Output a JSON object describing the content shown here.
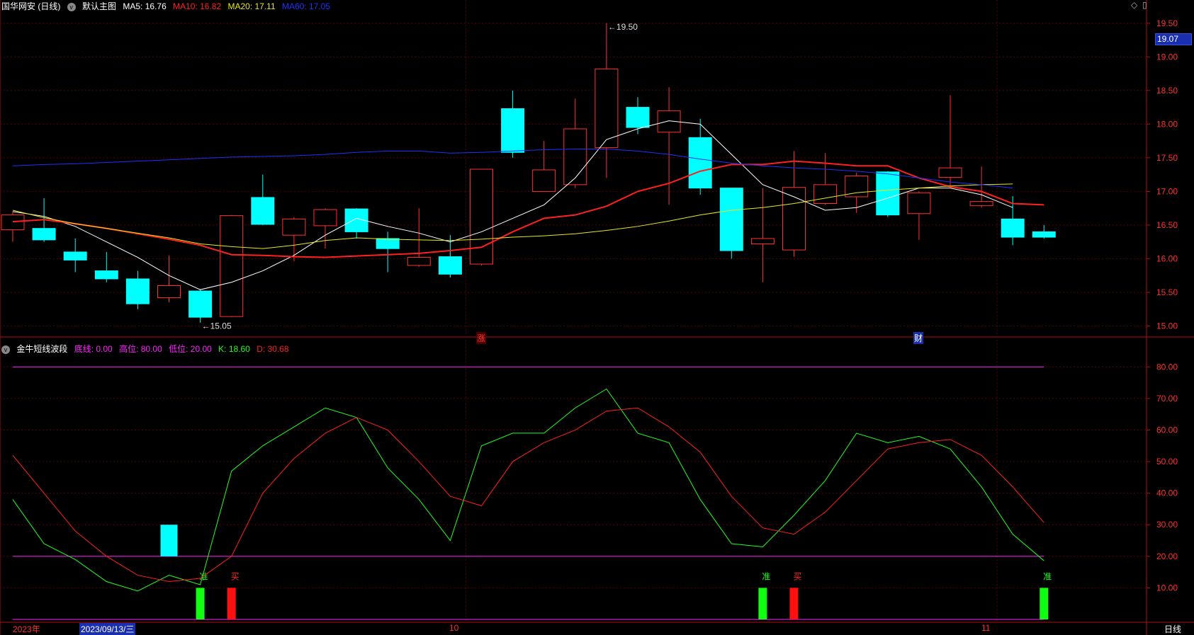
{
  "header": {
    "stock_title": "国华网安 (日线)",
    "main_chart_label": "默认主图",
    "ma5_label": "MA5: 16.76",
    "ma10_label": "MA10: 16.82",
    "ma20_label": "MA20: 17.11",
    "ma60_label": "MA60: 17.05",
    "corner_icons": [
      "diamond-icon",
      "window-icon"
    ]
  },
  "indicator_header": {
    "name": "金牛短线波段",
    "bottom_line": "底线: 0.00",
    "high_line": "高位: 80.00",
    "low_line": "低位: 20.00",
    "k_label": "K: 18.60",
    "d_label": "D: 30.68"
  },
  "last_price_box": "19.07",
  "footer": {
    "year_label": "2023年",
    "cursor_date": "2023/09/13/三",
    "month_oct": "10",
    "month_nov": "11",
    "period": "日线"
  },
  "markers": {
    "zhang": "涨",
    "cai": "财",
    "high_annot": "19.50",
    "low_annot": "15.05",
    "zhun": "准",
    "mai": "买"
  },
  "colors": {
    "up": "#ff3030",
    "down": "#00ffff",
    "ma5": "#ffffff",
    "ma10": "#ff2020",
    "ma20": "#e8e820",
    "ma60": "#2030ff",
    "k_line": "#20ff20",
    "d_line": "#ff2020",
    "level_line": "#ff20ff"
  },
  "chart_data": [
    {
      "type": "candlestick",
      "title": "国华网安 (日线)",
      "ylim": [
        14.9,
        19.55
      ],
      "y_ticks": [
        "15.00",
        "15.50",
        "16.00",
        "16.50",
        "17.00",
        "17.50",
        "18.00",
        "18.50",
        "19.00",
        "19.50"
      ],
      "candles": [
        {
          "o": 16.43,
          "c": 16.65,
          "h": 16.7,
          "l": 16.25
        },
        {
          "o": 16.45,
          "c": 16.28,
          "h": 16.9,
          "l": 16.25
        },
        {
          "o": 16.1,
          "c": 15.98,
          "h": 16.3,
          "l": 15.8
        },
        {
          "o": 15.82,
          "c": 15.7,
          "h": 16.1,
          "l": 15.65
        },
        {
          "o": 15.7,
          "c": 15.33,
          "h": 15.82,
          "l": 15.25
        },
        {
          "o": 15.42,
          "c": 15.6,
          "h": 16.05,
          "l": 15.35
        },
        {
          "o": 15.52,
          "c": 15.13,
          "h": 15.55,
          "l": 15.05
        },
        {
          "o": 15.14,
          "c": 16.64,
          "h": 16.65,
          "l": 15.13
        },
        {
          "o": 16.91,
          "c": 16.51,
          "h": 17.25,
          "l": 16.5
        },
        {
          "o": 16.35,
          "c": 16.59,
          "h": 16.62,
          "l": 15.96
        },
        {
          "o": 16.49,
          "c": 16.73,
          "h": 16.75,
          "l": 16.15
        },
        {
          "o": 16.74,
          "c": 16.4,
          "h": 16.75,
          "l": 16.3
        },
        {
          "o": 16.3,
          "c": 16.15,
          "h": 16.4,
          "l": 15.8
        },
        {
          "o": 15.9,
          "c": 16.02,
          "h": 16.75,
          "l": 15.88
        },
        {
          "o": 16.03,
          "c": 15.77,
          "h": 16.35,
          "l": 15.72
        },
        {
          "o": 15.92,
          "c": 17.33,
          "h": 17.33,
          "l": 15.9
        },
        {
          "o": 18.23,
          "c": 17.58,
          "h": 18.5,
          "l": 17.5
        },
        {
          "o": 17.0,
          "c": 17.32,
          "h": 17.75,
          "l": 17.0
        },
        {
          "o": 17.1,
          "c": 17.93,
          "h": 18.38,
          "l": 17.05
        },
        {
          "o": 17.65,
          "c": 18.82,
          "h": 19.5,
          "l": 17.2
        },
        {
          "o": 18.25,
          "c": 17.95,
          "h": 18.4,
          "l": 17.85
        },
        {
          "o": 17.88,
          "c": 18.2,
          "h": 18.55,
          "l": 16.8
        },
        {
          "o": 17.8,
          "c": 17.05,
          "h": 18.08,
          "l": 16.95
        },
        {
          "o": 17.05,
          "c": 16.12,
          "h": 17.05,
          "l": 16.0
        },
        {
          "o": 16.22,
          "c": 16.3,
          "h": 17.05,
          "l": 15.65
        },
        {
          "o": 16.13,
          "c": 17.06,
          "h": 17.6,
          "l": 16.03
        },
        {
          "o": 16.82,
          "c": 17.1,
          "h": 17.57,
          "l": 16.8
        },
        {
          "o": 16.92,
          "c": 17.23,
          "h": 17.28,
          "l": 16.68
        },
        {
          "o": 17.29,
          "c": 16.65,
          "h": 17.3,
          "l": 16.62
        },
        {
          "o": 16.67,
          "c": 16.98,
          "h": 17.0,
          "l": 16.28
        },
        {
          "o": 17.21,
          "c": 17.35,
          "h": 18.43,
          "l": 17.08
        },
        {
          "o": 16.79,
          "c": 16.85,
          "h": 17.37,
          "l": 16.76
        },
        {
          "o": 16.59,
          "c": 16.32,
          "h": 16.93,
          "l": 16.2
        },
        {
          "o": 16.4,
          "c": 16.32,
          "h": 16.5,
          "l": 16.3
        }
      ],
      "series": [
        {
          "name": "MA5",
          "values": [
            16.7,
            16.63,
            16.48,
            16.25,
            16.02,
            15.75,
            15.54,
            15.65,
            15.82,
            16.05,
            16.35,
            16.6,
            16.48,
            16.38,
            16.25,
            16.4,
            16.6,
            16.8,
            17.2,
            17.77,
            17.93,
            18.05,
            18.0,
            17.55,
            17.1,
            16.92,
            16.72,
            16.76,
            16.9,
            17.05,
            17.05,
            16.95,
            16.76
          ]
        },
        {
          "name": "MA10",
          "values": [
            16.55,
            16.58,
            16.52,
            16.45,
            16.37,
            16.29,
            16.2,
            16.06,
            16.05,
            16.03,
            16.02,
            16.04,
            16.06,
            16.08,
            16.12,
            16.17,
            16.4,
            16.6,
            16.65,
            16.78,
            17.0,
            17.12,
            17.3,
            17.4,
            17.4,
            17.45,
            17.42,
            17.38,
            17.38,
            17.2,
            17.07,
            17.0,
            16.82,
            16.8
          ]
        },
        {
          "name": "MA20",
          "values": [
            16.72,
            16.61,
            16.52,
            16.45,
            16.38,
            16.31,
            16.22,
            16.18,
            16.15,
            16.2,
            16.27,
            16.31,
            16.29,
            16.28,
            16.27,
            16.29,
            16.32,
            16.34,
            16.37,
            16.42,
            16.48,
            16.56,
            16.65,
            16.72,
            16.76,
            16.82,
            16.9,
            16.98,
            17.02,
            17.05,
            17.08,
            17.1,
            17.11
          ]
        },
        {
          "name": "MA60",
          "values": [
            17.38,
            17.4,
            17.41,
            17.43,
            17.45,
            17.47,
            17.49,
            17.51,
            17.52,
            17.53,
            17.55,
            17.58,
            17.6,
            17.6,
            17.57,
            17.58,
            17.6,
            17.62,
            17.63,
            17.63,
            17.6,
            17.55,
            17.48,
            17.42,
            17.38,
            17.35,
            17.33,
            17.3,
            17.26,
            17.2,
            17.14,
            17.1,
            17.05
          ]
        }
      ]
    },
    {
      "type": "line",
      "title": "金牛短线波段",
      "ylim": [
        0,
        85
      ],
      "y_ticks": [
        "10.00",
        "20.00",
        "30.00",
        "40.00",
        "50.00",
        "60.00",
        "70.00",
        "80.00"
      ],
      "levels": [
        0,
        20,
        80
      ],
      "series": [
        {
          "name": "K",
          "values": [
            38,
            24,
            19,
            12,
            9,
            14,
            11,
            47,
            55,
            61,
            67,
            64,
            48,
            38,
            25,
            55,
            59,
            59,
            67,
            73,
            59,
            56,
            38,
            24,
            23,
            33,
            44,
            59,
            56,
            58,
            54,
            42,
            27,
            18.6
          ]
        },
        {
          "name": "D",
          "values": [
            52,
            40,
            28,
            20,
            14,
            12,
            13,
            20,
            40,
            51,
            59,
            64,
            60,
            50,
            39,
            36,
            50,
            56,
            60,
            66,
            67,
            61,
            53,
            39,
            29,
            27,
            34,
            44,
            54,
            56,
            57,
            52,
            42,
            30.68
          ]
        }
      ],
      "bars": [
        {
          "index": 5,
          "from": 20,
          "to": 30,
          "kind": "cyan"
        },
        {
          "index": 6,
          "from": 0,
          "to": 10,
          "kind": "green",
          "label": "准"
        },
        {
          "index": 7,
          "from": 0,
          "to": 10,
          "kind": "red",
          "label": "买"
        },
        {
          "index": 24,
          "from": 0,
          "to": 10,
          "kind": "green",
          "label": "准"
        },
        {
          "index": 25,
          "from": 0,
          "to": 10,
          "kind": "red",
          "label": "买"
        },
        {
          "index": 33,
          "from": 0,
          "to": 10,
          "kind": "green",
          "label": "准"
        }
      ]
    }
  ]
}
